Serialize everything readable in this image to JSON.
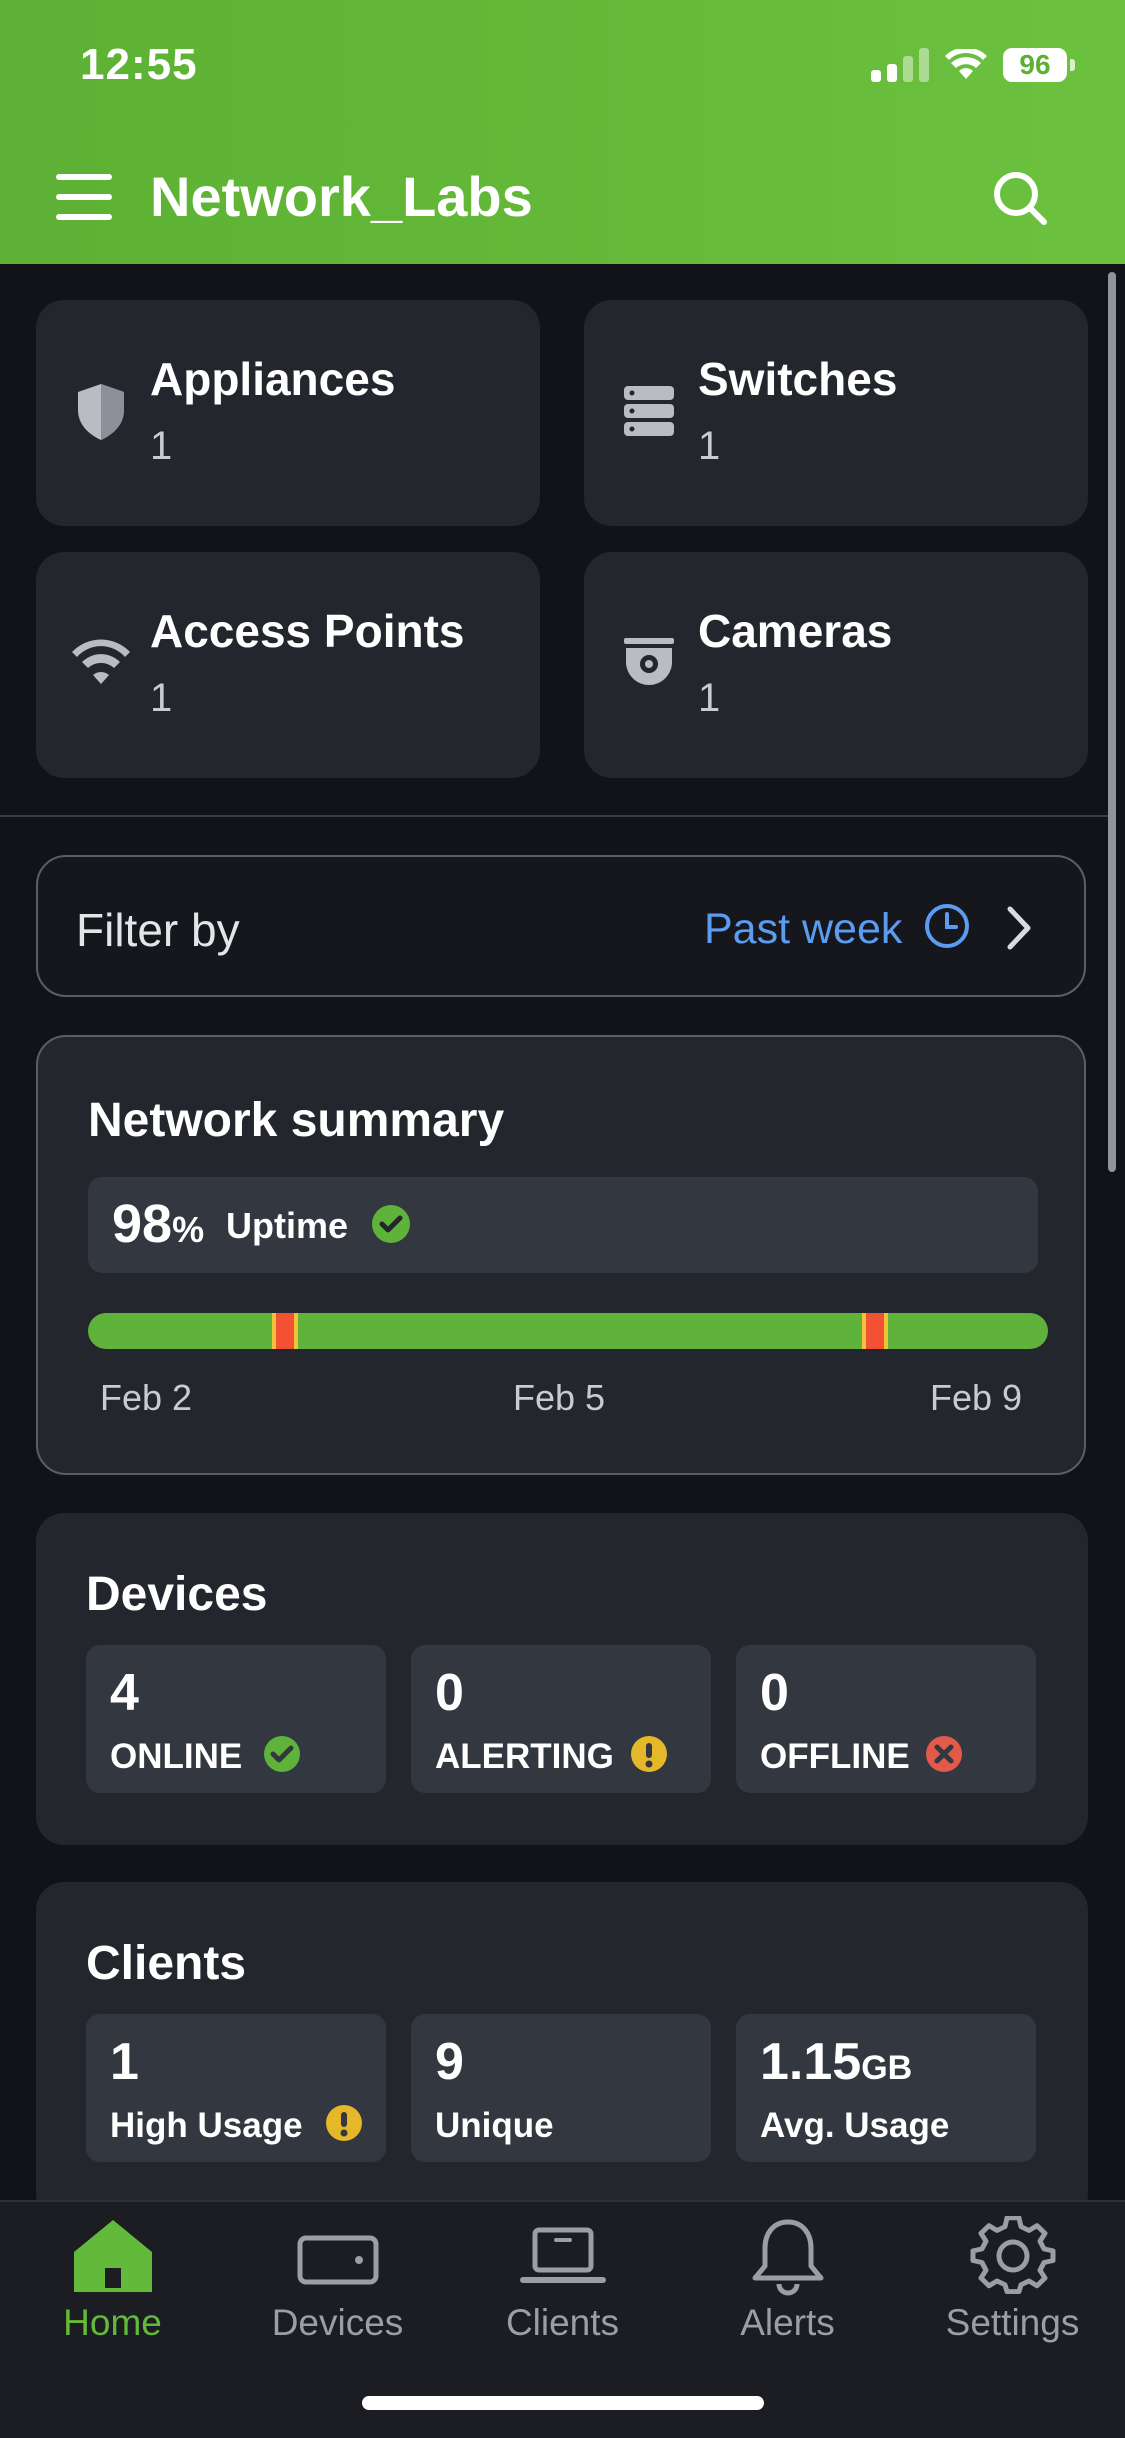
{
  "status": {
    "time": "12:55",
    "battery": "96"
  },
  "app": {
    "title": "Network_Labs"
  },
  "categories": [
    {
      "label": "Appliances",
      "count": "1",
      "icon": "shield-icon"
    },
    {
      "label": "Switches",
      "count": "1",
      "icon": "server-stack-icon"
    },
    {
      "label": "Access Points",
      "count": "1",
      "icon": "wifi-icon"
    },
    {
      "label": "Cameras",
      "count": "1",
      "icon": "camera-icon"
    }
  ],
  "filter": {
    "label": "Filter by",
    "value": "Past week"
  },
  "summary": {
    "title": "Network summary",
    "uptime_value": "98",
    "uptime_unit": "%",
    "uptime_label": "Uptime",
    "outages_fraction": [
      0.205,
      0.82
    ],
    "dates": [
      "Feb 2",
      "Feb 5",
      "Feb 9"
    ]
  },
  "devices": {
    "title": "Devices",
    "stats": [
      {
        "value": "4",
        "label": "ONLINE",
        "status_color": "#5fb33a"
      },
      {
        "value": "0",
        "label": "ALERTING",
        "status_color": "#e5b82a"
      },
      {
        "value": "0",
        "label": "OFFLINE",
        "status_color": "#e35a4a"
      }
    ]
  },
  "clients": {
    "title": "Clients",
    "stats": [
      {
        "value": "1",
        "unit": "",
        "label": "High Usage"
      },
      {
        "value": "9",
        "unit": "",
        "label": "Unique"
      },
      {
        "value": "1.15",
        "unit": "GB",
        "label": "Avg. Usage"
      }
    ]
  },
  "tabs": [
    {
      "label": "Home",
      "active": true
    },
    {
      "label": "Devices",
      "active": false
    },
    {
      "label": "Clients",
      "active": false
    },
    {
      "label": "Alerts",
      "active": false
    },
    {
      "label": "Settings",
      "active": false
    }
  ],
  "colors": {
    "brand": "#62b93a",
    "link": "#5b9cf0",
    "card": "#23262d",
    "background": "#111318"
  }
}
